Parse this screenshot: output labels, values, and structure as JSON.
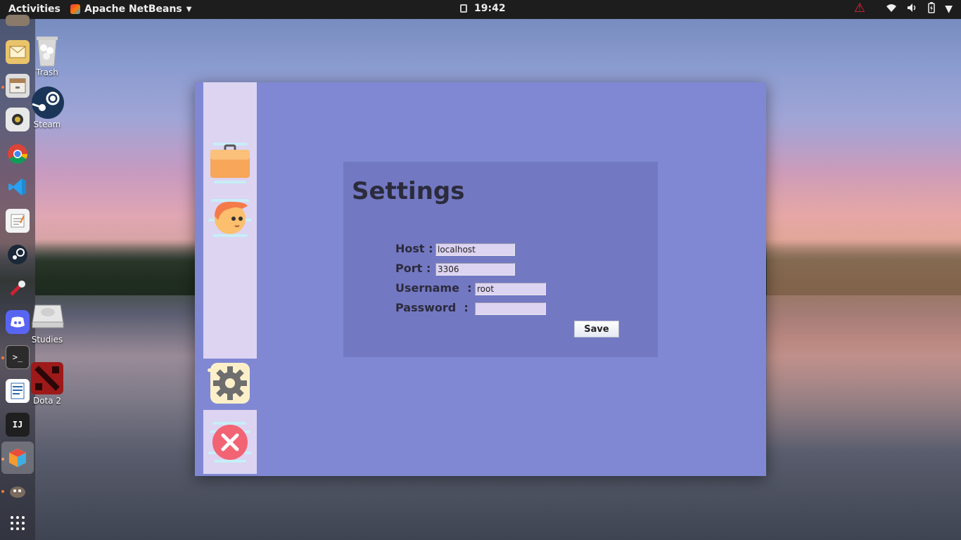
{
  "topbar": {
    "activities": "Activities",
    "app_name": "Apache NetBeans",
    "time": "19:42"
  },
  "desktop_icons": {
    "trash": "Trash",
    "steam": "Steam",
    "studies": "Studies",
    "dota": "Dota 2"
  },
  "window": {
    "title": "Settings",
    "fields": {
      "host_label": "Host :",
      "host_value": "localhost",
      "port_label": "Port :",
      "port_value": "3306",
      "username_label": "Username  :",
      "username_value": "root",
      "password_label": "Password  :",
      "password_value": ""
    },
    "save_label": "Save"
  },
  "colors": {
    "window_bg": "#8088d3",
    "panel_bg": "#7378c2",
    "sidebar_bg": "#dcd4f1",
    "input_bg": "#dcd4f1"
  }
}
